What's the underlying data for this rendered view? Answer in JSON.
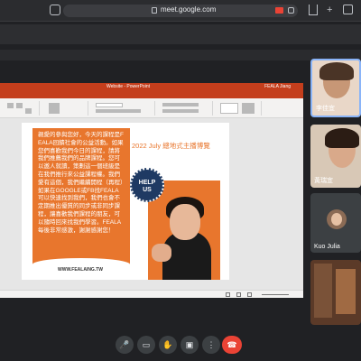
{
  "browser": {
    "url": "meet.google.com"
  },
  "ppt": {
    "window_title": "Website - PowerPoint",
    "user": "FEALA Jiang"
  },
  "slide": {
    "body_text": "親愛的參與您好，今天的課程是FEALA回饋社會的公益活動。如果您們喜歡我們今日的課程，請將我們推薦我們的品牌課程。您可以邀人就讀，策劃這一個班級是在我們推行來公益課程權。我們愛有這個，我們繼續開程（再程）如果在GOOGLE或FB找FEALA可以快速找到我們，我們也會不定期推出優質的同步或非同步課程，讓喜歡我們課程的朋友，可以隨時回來找我們學習。FEALA每後非常感激，謝謝感謝您！",
    "title": "2022 July 總地式主播博覽",
    "help_line1": "HELP",
    "help_line2": "US",
    "url": "WWW.FEALAING.TW"
  },
  "participants": [
    {
      "name": "李佳宜"
    },
    {
      "name": "黃瑞宜"
    },
    {
      "name": "Kuo Julia"
    },
    {
      "name": ""
    }
  ],
  "controls": {
    "mic": "🎤",
    "camera": "▭",
    "hand": "✋",
    "present": "▣",
    "more": "⋮",
    "hangup": "☎"
  },
  "colors": {
    "slide_orange": "#e8762d",
    "ppt_red": "#c43e1c",
    "hangup_red": "#ea4335",
    "help_navy": "#1f3a63"
  }
}
